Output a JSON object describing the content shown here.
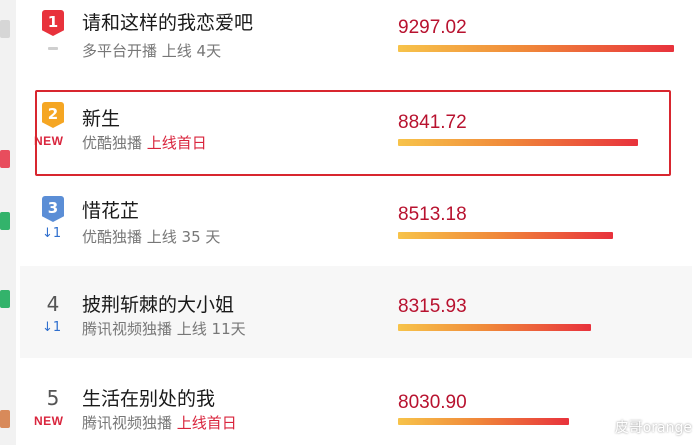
{
  "items": [
    {
      "rank": "1",
      "badge_color": "#e8323c",
      "title": "请和这样的我恋爱吧",
      "sub_prefix": "多平台开播 上线 4天",
      "sub_highlight": "",
      "score": "9297.02",
      "bar_fraction": 1.0
    },
    {
      "rank": "2",
      "badge_color": "#f5a623",
      "tag": "NEW",
      "title": "新生",
      "sub_prefix": "优酷独播 ",
      "sub_highlight": "上线首日",
      "score": "8841.72",
      "bar_fraction": 0.87
    },
    {
      "rank": "3",
      "badge_color": "#5b8ed6",
      "change": "1",
      "title": "惜花芷",
      "sub_prefix": "优酷独播 上线 35 天",
      "sub_highlight": "",
      "score": "8513.18",
      "bar_fraction": 0.78
    },
    {
      "rank": "4",
      "change": "1",
      "title": "披荆斩棘的大小姐",
      "sub_prefix": "腾讯视频独播 上线 11天",
      "sub_highlight": "",
      "score": "8315.93",
      "bar_fraction": 0.7
    },
    {
      "rank": "5",
      "tag": "NEW",
      "title": "生活在别处的我",
      "sub_prefix": "腾讯视频独播 ",
      "sub_highlight": "上线首日",
      "score": "8030.90",
      "bar_fraction": 0.62
    }
  ],
  "arrow_glyph": "↓",
  "watermark": "皮哥orange",
  "accent_color": "#d9253d"
}
